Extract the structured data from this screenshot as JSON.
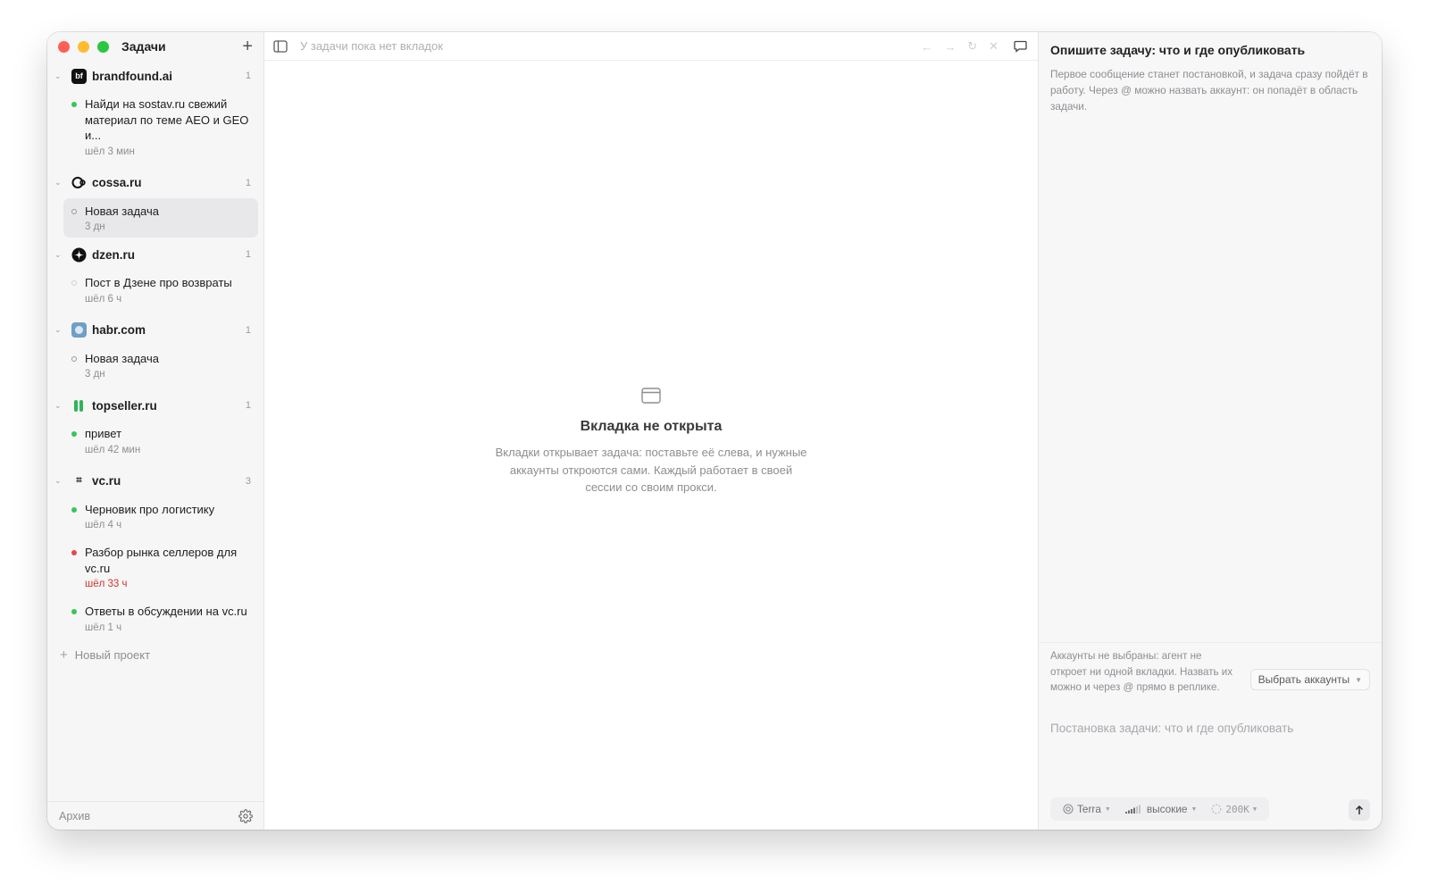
{
  "sidebar": {
    "title": "Задачи",
    "new_project_label": "Новый проект",
    "archive_label": "Архив",
    "projects": [
      {
        "name": "brandfound.ai",
        "count": "1",
        "icon_text": "bf",
        "tasks": [
          {
            "title": "Найди на sostav.ru свежий материал по теме AEO и GEO и...",
            "meta": "шёл 3 мин",
            "status": "running"
          }
        ]
      },
      {
        "name": "cossa.ru",
        "count": "1",
        "tasks": [
          {
            "title": "Новая задача",
            "meta": "3 дн",
            "status": "idle"
          }
        ]
      },
      {
        "name": "dzen.ru",
        "count": "1",
        "tasks": [
          {
            "title": "Пост в Дзене про возвраты",
            "meta": "шёл 6 ч",
            "status": "idle-light"
          }
        ]
      },
      {
        "name": "habr.com",
        "count": "1",
        "tasks": [
          {
            "title": "Новая задача",
            "meta": "3 дн",
            "status": "idle"
          }
        ]
      },
      {
        "name": "topseller.ru",
        "count": "1",
        "tasks": [
          {
            "title": "привет",
            "meta": "шёл 42 мин",
            "status": "running"
          }
        ]
      },
      {
        "name": "vc.ru",
        "count": "3",
        "tasks": [
          {
            "title": "Черновик про логистику",
            "meta": "шёл 4 ч",
            "status": "running"
          },
          {
            "title": "Разбор рынка селлеров для vc.ru",
            "meta": "шёл 33 ч",
            "status": "error"
          },
          {
            "title": "Ответы в обсуждении на vc.ru",
            "meta": "шёл 1 ч",
            "status": "running"
          }
        ]
      }
    ]
  },
  "main": {
    "no_tabs_text": "У задачи пока нет вкладок",
    "empty_title": "Вкладка не открыта",
    "empty_text": "Вкладки открывает задача: поставьте её слева, и нужные аккаунты откроются сами. Каждый работает в своей сессии со своим прокси."
  },
  "panel": {
    "title": "Опишите задачу: что и где опубликовать",
    "description": "Первое сообщение станет постановкой, и задача сразу пойдёт в работу. Через @ можно назвать аккаунт: он попадёт в область задачи.",
    "accounts_warning": "Аккаунты не выбраны: агент не откроет ни одной вкладки. Назвать их можно и через @ прямо в реплике.",
    "choose_accounts_label": "Выбрать аккаунты",
    "input_placeholder": "Постановка задачи: что и где опубликовать",
    "model_label": "Terra",
    "effort_label": "высокие",
    "context_label": "200K"
  },
  "colors": {
    "running": "#34c759",
    "error": "#e5484d",
    "idle_ring": "#b5b5ba",
    "traffic_red": "#ff5f57",
    "traffic_yellow": "#febc2e",
    "traffic_green": "#28c840"
  },
  "icons": {
    "new_task": "plus-icon",
    "sidebar_toggle": "sidebar-toggle-icon",
    "back": "arrow-left-icon",
    "forward": "arrow-right-icon",
    "reload": "reload-icon",
    "close": "close-icon",
    "chat": "chat-bubble-icon",
    "settings": "gear-icon",
    "send": "arrow-up-icon"
  }
}
